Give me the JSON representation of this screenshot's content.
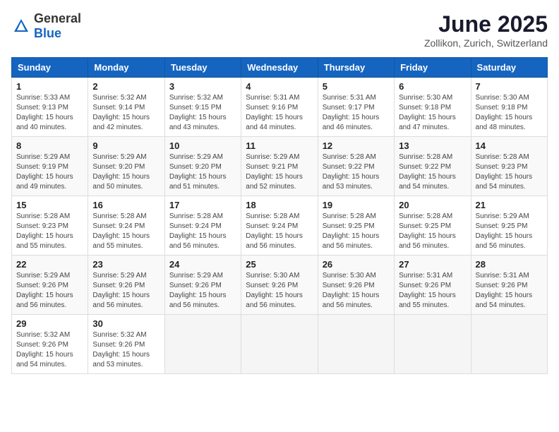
{
  "header": {
    "logo_general": "General",
    "logo_blue": "Blue",
    "title": "June 2025",
    "subtitle": "Zollikon, Zurich, Switzerland"
  },
  "days_of_week": [
    "Sunday",
    "Monday",
    "Tuesday",
    "Wednesday",
    "Thursday",
    "Friday",
    "Saturday"
  ],
  "weeks": [
    [
      {
        "day": "1",
        "sunrise": "5:33 AM",
        "sunset": "9:13 PM",
        "daylight": "15 hours and 40 minutes."
      },
      {
        "day": "2",
        "sunrise": "5:32 AM",
        "sunset": "9:14 PM",
        "daylight": "15 hours and 42 minutes."
      },
      {
        "day": "3",
        "sunrise": "5:32 AM",
        "sunset": "9:15 PM",
        "daylight": "15 hours and 43 minutes."
      },
      {
        "day": "4",
        "sunrise": "5:31 AM",
        "sunset": "9:16 PM",
        "daylight": "15 hours and 44 minutes."
      },
      {
        "day": "5",
        "sunrise": "5:31 AM",
        "sunset": "9:17 PM",
        "daylight": "15 hours and 46 minutes."
      },
      {
        "day": "6",
        "sunrise": "5:30 AM",
        "sunset": "9:18 PM",
        "daylight": "15 hours and 47 minutes."
      },
      {
        "day": "7",
        "sunrise": "5:30 AM",
        "sunset": "9:18 PM",
        "daylight": "15 hours and 48 minutes."
      }
    ],
    [
      {
        "day": "8",
        "sunrise": "5:29 AM",
        "sunset": "9:19 PM",
        "daylight": "15 hours and 49 minutes."
      },
      {
        "day": "9",
        "sunrise": "5:29 AM",
        "sunset": "9:20 PM",
        "daylight": "15 hours and 50 minutes."
      },
      {
        "day": "10",
        "sunrise": "5:29 AM",
        "sunset": "9:20 PM",
        "daylight": "15 hours and 51 minutes."
      },
      {
        "day": "11",
        "sunrise": "5:29 AM",
        "sunset": "9:21 PM",
        "daylight": "15 hours and 52 minutes."
      },
      {
        "day": "12",
        "sunrise": "5:28 AM",
        "sunset": "9:22 PM",
        "daylight": "15 hours and 53 minutes."
      },
      {
        "day": "13",
        "sunrise": "5:28 AM",
        "sunset": "9:22 PM",
        "daylight": "15 hours and 54 minutes."
      },
      {
        "day": "14",
        "sunrise": "5:28 AM",
        "sunset": "9:23 PM",
        "daylight": "15 hours and 54 minutes."
      }
    ],
    [
      {
        "day": "15",
        "sunrise": "5:28 AM",
        "sunset": "9:23 PM",
        "daylight": "15 hours and 55 minutes."
      },
      {
        "day": "16",
        "sunrise": "5:28 AM",
        "sunset": "9:24 PM",
        "daylight": "15 hours and 55 minutes."
      },
      {
        "day": "17",
        "sunrise": "5:28 AM",
        "sunset": "9:24 PM",
        "daylight": "15 hours and 56 minutes."
      },
      {
        "day": "18",
        "sunrise": "5:28 AM",
        "sunset": "9:24 PM",
        "daylight": "15 hours and 56 minutes."
      },
      {
        "day": "19",
        "sunrise": "5:28 AM",
        "sunset": "9:25 PM",
        "daylight": "15 hours and 56 minutes."
      },
      {
        "day": "20",
        "sunrise": "5:28 AM",
        "sunset": "9:25 PM",
        "daylight": "15 hours and 56 minutes."
      },
      {
        "day": "21",
        "sunrise": "5:29 AM",
        "sunset": "9:25 PM",
        "daylight": "15 hours and 56 minutes."
      }
    ],
    [
      {
        "day": "22",
        "sunrise": "5:29 AM",
        "sunset": "9:26 PM",
        "daylight": "15 hours and 56 minutes."
      },
      {
        "day": "23",
        "sunrise": "5:29 AM",
        "sunset": "9:26 PM",
        "daylight": "15 hours and 56 minutes."
      },
      {
        "day": "24",
        "sunrise": "5:29 AM",
        "sunset": "9:26 PM",
        "daylight": "15 hours and 56 minutes."
      },
      {
        "day": "25",
        "sunrise": "5:30 AM",
        "sunset": "9:26 PM",
        "daylight": "15 hours and 56 minutes."
      },
      {
        "day": "26",
        "sunrise": "5:30 AM",
        "sunset": "9:26 PM",
        "daylight": "15 hours and 56 minutes."
      },
      {
        "day": "27",
        "sunrise": "5:31 AM",
        "sunset": "9:26 PM",
        "daylight": "15 hours and 55 minutes."
      },
      {
        "day": "28",
        "sunrise": "5:31 AM",
        "sunset": "9:26 PM",
        "daylight": "15 hours and 54 minutes."
      }
    ],
    [
      {
        "day": "29",
        "sunrise": "5:32 AM",
        "sunset": "9:26 PM",
        "daylight": "15 hours and 54 minutes."
      },
      {
        "day": "30",
        "sunrise": "5:32 AM",
        "sunset": "9:26 PM",
        "daylight": "15 hours and 53 minutes."
      },
      null,
      null,
      null,
      null,
      null
    ]
  ]
}
